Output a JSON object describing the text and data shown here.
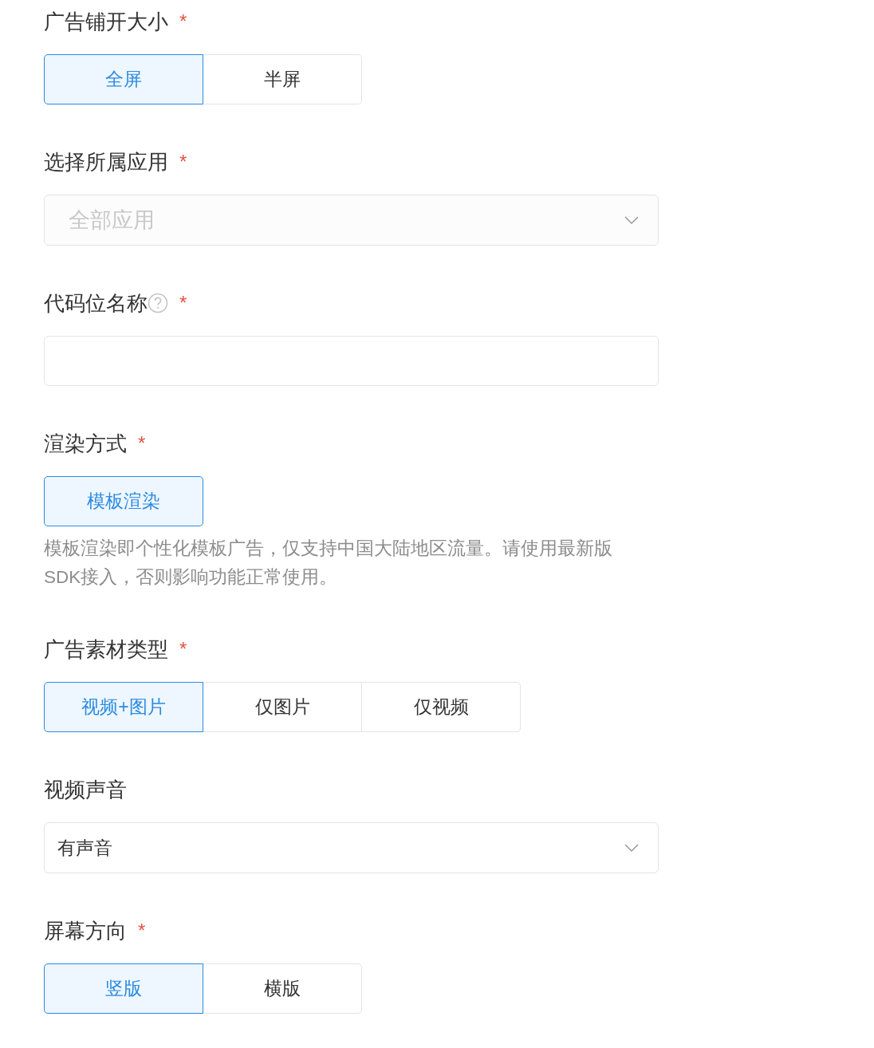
{
  "fields": [
    {
      "kind": "segmented",
      "label": "广告铺开大小",
      "required_mark": "*",
      "help": false,
      "options": [
        {
          "label": "全屏",
          "selected": true
        },
        {
          "label": "半屏",
          "selected": false
        }
      ]
    },
    {
      "kind": "select",
      "label": "选择所属应用",
      "required_mark": "*",
      "help": false,
      "placeholder": "全部应用"
    },
    {
      "kind": "input",
      "label": "代码位名称",
      "required_mark": "*",
      "help": true
    },
    {
      "kind": "segmented",
      "label": "渲染方式",
      "required_mark": "*",
      "help": false,
      "options": [
        {
          "label": "模板渲染",
          "selected": true
        }
      ],
      "hint": "模板渲染即个性化模板广告，仅支持中国大陆地区流量。请使用最新版SDK接入，否则影响功能正常使用。"
    },
    {
      "kind": "segmented",
      "label": "广告素材类型",
      "required_mark": "*",
      "help": false,
      "options": [
        {
          "label": "视频+图片",
          "selected": true
        },
        {
          "label": "仅图片",
          "selected": false
        },
        {
          "label": "仅视频",
          "selected": false
        }
      ]
    },
    {
      "kind": "select",
      "label": "视频声音",
      "help": false,
      "value": "有声音"
    },
    {
      "kind": "segmented",
      "label": "屏幕方向",
      "required_mark": "*",
      "help": false,
      "options": [
        {
          "label": "竖版",
          "selected": true
        },
        {
          "label": "横版",
          "selected": false
        }
      ]
    }
  ]
}
